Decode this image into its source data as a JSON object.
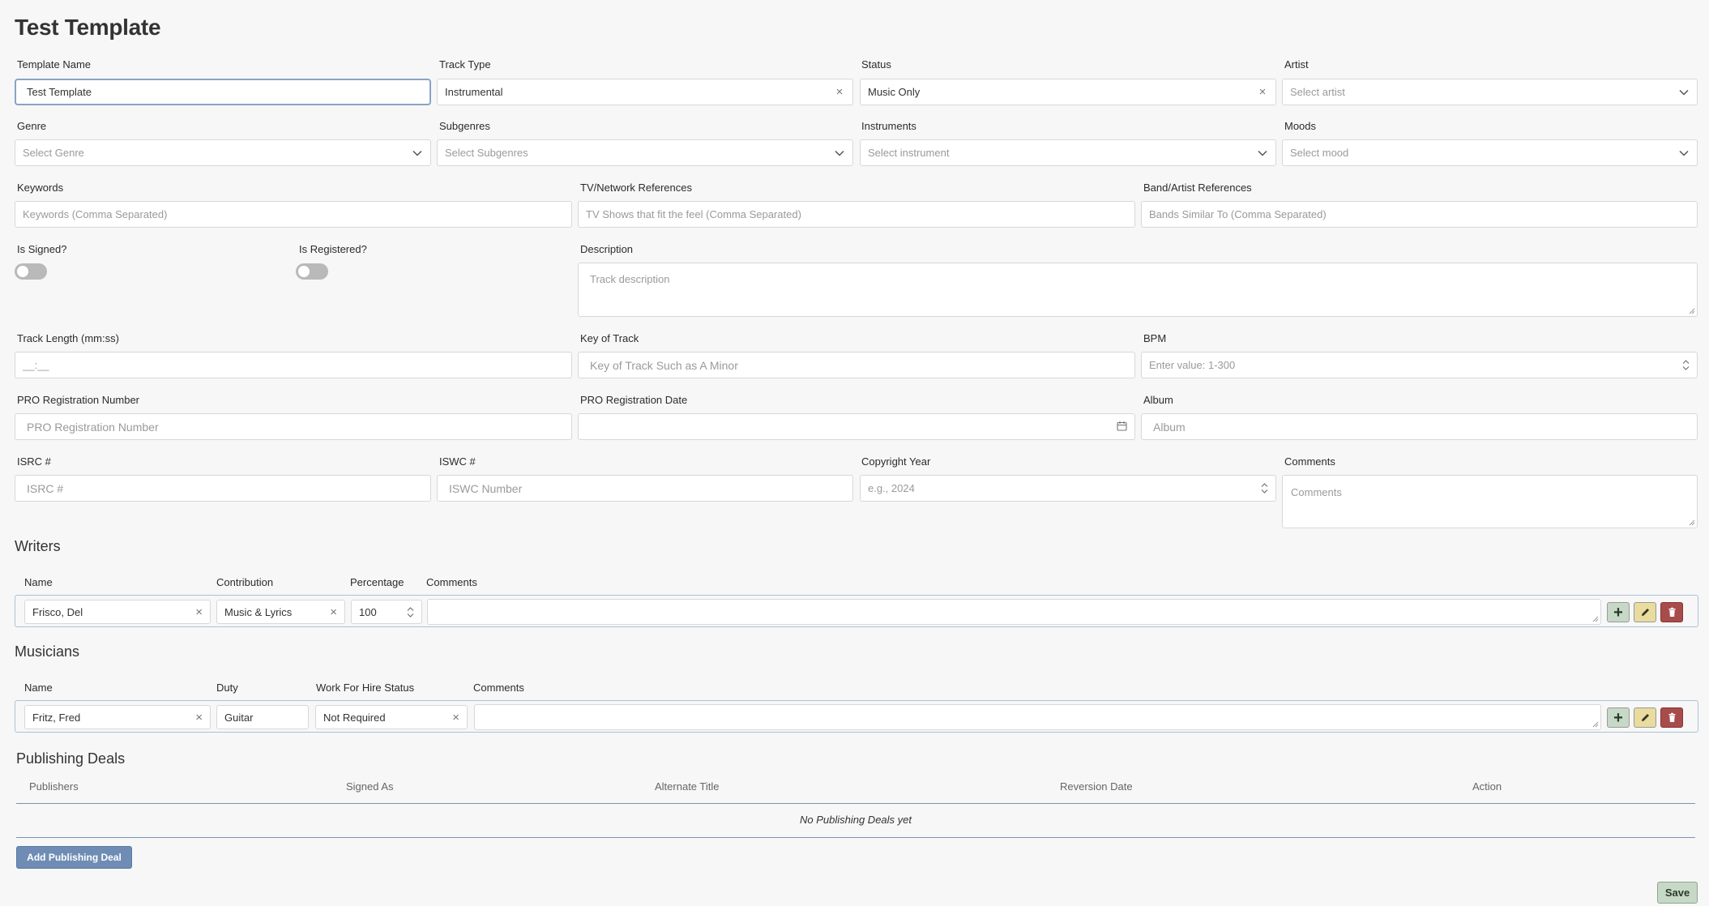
{
  "page": {
    "title": "Test Template"
  },
  "form": {
    "template_name": {
      "label": "Template Name",
      "value": "Test Template"
    },
    "track_type": {
      "label": "Track Type",
      "value": "Instrumental"
    },
    "status": {
      "label": "Status",
      "value": "Music Only"
    },
    "artist": {
      "label": "Artist",
      "placeholder": "Select artist"
    },
    "genre": {
      "label": "Genre",
      "placeholder": "Select Genre"
    },
    "subgenres": {
      "label": "Subgenres",
      "placeholder": "Select Subgenres"
    },
    "instruments": {
      "label": "Instruments",
      "placeholder": "Select instrument"
    },
    "moods": {
      "label": "Moods",
      "placeholder": "Select mood"
    },
    "keywords": {
      "label": "Keywords",
      "placeholder": "Keywords (Comma Separated)"
    },
    "tv_refs": {
      "label": "TV/Network References",
      "placeholder": "TV Shows that fit the feel (Comma Separated)"
    },
    "band_refs": {
      "label": "Band/Artist References",
      "placeholder": "Bands Similar To (Comma Separated)"
    },
    "is_signed": {
      "label": "Is Signed?",
      "checked": false
    },
    "is_registered": {
      "label": "Is Registered?",
      "checked": false
    },
    "description": {
      "label": "Description",
      "placeholder": "Track description"
    },
    "track_length": {
      "label": "Track Length (mm:ss)",
      "placeholder": "__:__"
    },
    "key_of_track": {
      "label": "Key of Track",
      "placeholder": "Key of Track Such as A Minor"
    },
    "bpm": {
      "label": "BPM",
      "placeholder": "Enter value: 1-300"
    },
    "pro_number": {
      "label": "PRO Registration Number",
      "placeholder": "PRO Registration Number"
    },
    "pro_date": {
      "label": "PRO Registration Date"
    },
    "album": {
      "label": "Album",
      "placeholder": "Album"
    },
    "isrc": {
      "label": "ISRC #",
      "placeholder": "ISRC #"
    },
    "iswc": {
      "label": "ISWC #",
      "placeholder": "ISWC Number"
    },
    "copyright_year": {
      "label": "Copyright Year",
      "placeholder": "e.g., 2024"
    },
    "comments": {
      "label": "Comments",
      "placeholder": "Comments"
    }
  },
  "writers": {
    "title": "Writers",
    "headers": {
      "name": "Name",
      "contribution": "Contribution",
      "percentage": "Percentage",
      "comments": "Comments"
    },
    "row": {
      "name": "Frisco, Del",
      "contribution": "Music & Lyrics",
      "percentage": "100",
      "comments": ""
    }
  },
  "musicians": {
    "title": "Musicians",
    "headers": {
      "name": "Name",
      "duty": "Duty",
      "wfh": "Work For Hire Status",
      "comments": "Comments"
    },
    "row": {
      "name": "Fritz, Fred",
      "duty": "Guitar",
      "wfh": "Not Required",
      "comments": ""
    }
  },
  "publishing": {
    "title": "Publishing Deals",
    "columns": [
      "Publishers",
      "Signed As",
      "Alternate Title",
      "Reversion Date",
      "Action"
    ],
    "empty_text": "No Publishing Deals yet",
    "add_label": "Add Publishing Deal"
  },
  "actions": {
    "save_label": "Save",
    "add_symbol": "+"
  },
  "icons": {
    "clear": "×",
    "add": "plus-icon",
    "edit": "pencil-icon",
    "delete": "trash-icon",
    "dropdown": "chevron-down-icon",
    "calendar": "calendar-icon"
  },
  "colors": {
    "primary": "#6f8db4",
    "add_button": "#c6d8c6",
    "edit_button": "#e8dc9e",
    "delete_button": "#a84b4b"
  }
}
